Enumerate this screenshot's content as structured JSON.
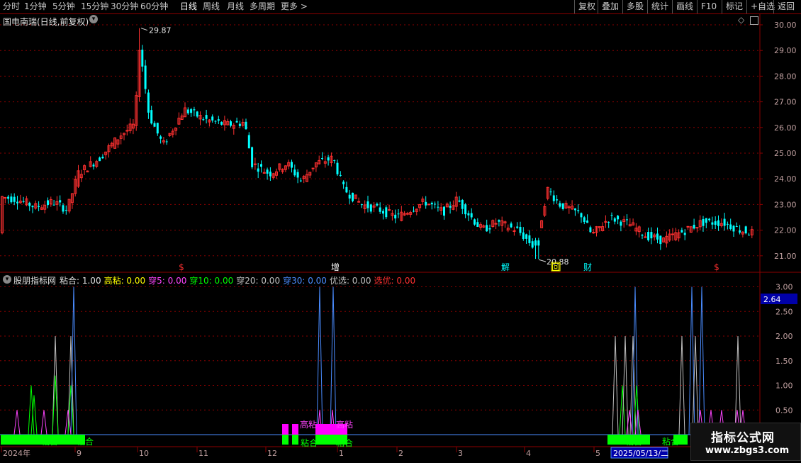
{
  "toolbar": {
    "period_tabs": [
      "分时",
      "1分钟",
      "5分钟",
      "15分钟",
      "30分钟",
      "60分钟",
      "日线",
      "周线",
      "月线",
      "多周期",
      "更多 >"
    ],
    "active_tab": "日线",
    "right_buttons": [
      "复权",
      "叠加",
      "多股",
      "统计",
      "画线",
      "F10",
      "标记",
      "+自选",
      "返回"
    ]
  },
  "main_chart": {
    "title": "国电南瑞(日线,前复权)",
    "y_ticks": [
      "30.00",
      "29.00",
      "28.00",
      "27.00",
      "26.00",
      "25.00",
      "24.00",
      "23.00",
      "22.00",
      "21.00"
    ],
    "high_label": "29.87",
    "low_label": "20.88",
    "event_markers": [
      {
        "text": "$",
        "color": "#ff3030"
      },
      {
        "text": "增",
        "color": "#ffffff"
      },
      {
        "text": "解",
        "color": "#00ffff"
      },
      {
        "text": "回",
        "color": "#ffff00"
      },
      {
        "text": "财",
        "color": "#00ffff"
      },
      {
        "text": "$",
        "color": "#ff3030"
      }
    ]
  },
  "indicator": {
    "name": "股朋指标网",
    "values": [
      {
        "label": "粘合:",
        "value": "1.00",
        "color": "#e0e0e0"
      },
      {
        "label": "高粘:",
        "value": "0.00",
        "color": "#ffff00"
      },
      {
        "label": "穿5:",
        "value": "0.00",
        "color": "#ff44ff"
      },
      {
        "label": "穿10:",
        "value": "0.00",
        "color": "#00ff00"
      },
      {
        "label": "穿20:",
        "value": "0.00",
        "color": "#c0c0c0"
      },
      {
        "label": "穿30:",
        "value": "0.00",
        "color": "#4a8cff"
      },
      {
        "label": "优选:",
        "value": "0.00",
        "color": "#c0c0c0"
      },
      {
        "label": "选优:",
        "value": "0.00",
        "color": "#ff3030"
      }
    ],
    "y_ticks": [
      "3.00",
      "2.50",
      "2.00",
      "1.50",
      "1.00",
      "0.50"
    ],
    "current_value": "2.64",
    "bar_labels": [
      "粘合",
      "粘合",
      "高粘",
      "高粘",
      "粘合",
      "粘合",
      "粘合",
      "粘合"
    ]
  },
  "x_axis": {
    "labels": [
      "2024年",
      "9",
      "10",
      "11",
      "12",
      "1",
      "2",
      "3",
      "4",
      "5"
    ],
    "cursor_date": "2025/05/13/二"
  },
  "watermark": {
    "line1": "指标公式网",
    "line2": "www.zbgs3.com"
  },
  "colors": {
    "up": "#ff3030",
    "down": "#00ffff",
    "grid": "#8b0000",
    "axis": "#c0c0c0",
    "sticky": "#00ff00",
    "high_sticky": "#ff00ff"
  }
}
